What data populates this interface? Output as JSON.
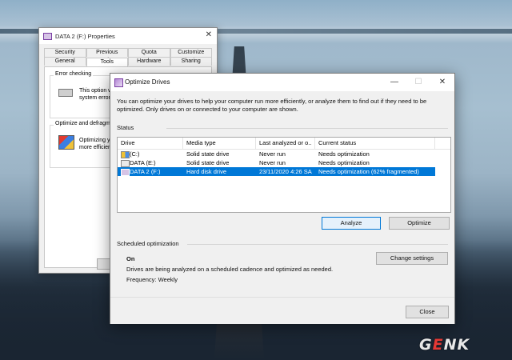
{
  "properties_window": {
    "title": "DATA 2 (F:) Properties",
    "tabs_row1": [
      "Security",
      "Previous Versions",
      "Quota",
      "Customize"
    ],
    "tabs_row2": [
      "General",
      "Tools",
      "Hardware",
      "Sharing"
    ],
    "active_tab": "Tools",
    "error_checking": {
      "title": "Error checking",
      "text": "This option will c... system errors."
    },
    "optimize": {
      "title": "Optimize and defragment",
      "text": "Optimizing your ... more efficiently."
    }
  },
  "optimize_window": {
    "title": "Optimize Drives",
    "description": "You can optimize your drives to help your computer run more efficiently, or analyze them to find out if they need to be optimized. Only drives on or connected to your computer are shown.",
    "status_label": "Status",
    "columns": [
      "Drive",
      "Media type",
      "Last analyzed or o...",
      "Current status"
    ],
    "drives": [
      {
        "drive": "(C:)",
        "media": "Solid state drive",
        "last": "Never run",
        "status": "Needs optimization",
        "icon": "windows-drive-icon",
        "selected": false
      },
      {
        "drive": "DATA (E:)",
        "media": "Solid state drive",
        "last": "Never run",
        "status": "Needs optimization",
        "icon": "drive-icon",
        "selected": false
      },
      {
        "drive": "DATA 2 (F:)",
        "media": "Hard disk drive",
        "last": "23/11/2020 4:26 SA",
        "status": "Needs optimization (62% fragmented)",
        "icon": "hdd-icon",
        "selected": true
      }
    ],
    "buttons": {
      "analyze": "Analyze",
      "optimize": "Optimize",
      "change_settings": "Change settings",
      "close": "Close"
    },
    "scheduled": {
      "label": "Scheduled optimization",
      "state": "On",
      "text": "Drives are being analyzed on a scheduled cadence and optimized as needed.",
      "frequency": "Frequency: Weekly"
    }
  },
  "watermark": {
    "text": "GENK",
    "accent_color": "#e53935"
  },
  "colors": {
    "selection": "#0078d7"
  }
}
